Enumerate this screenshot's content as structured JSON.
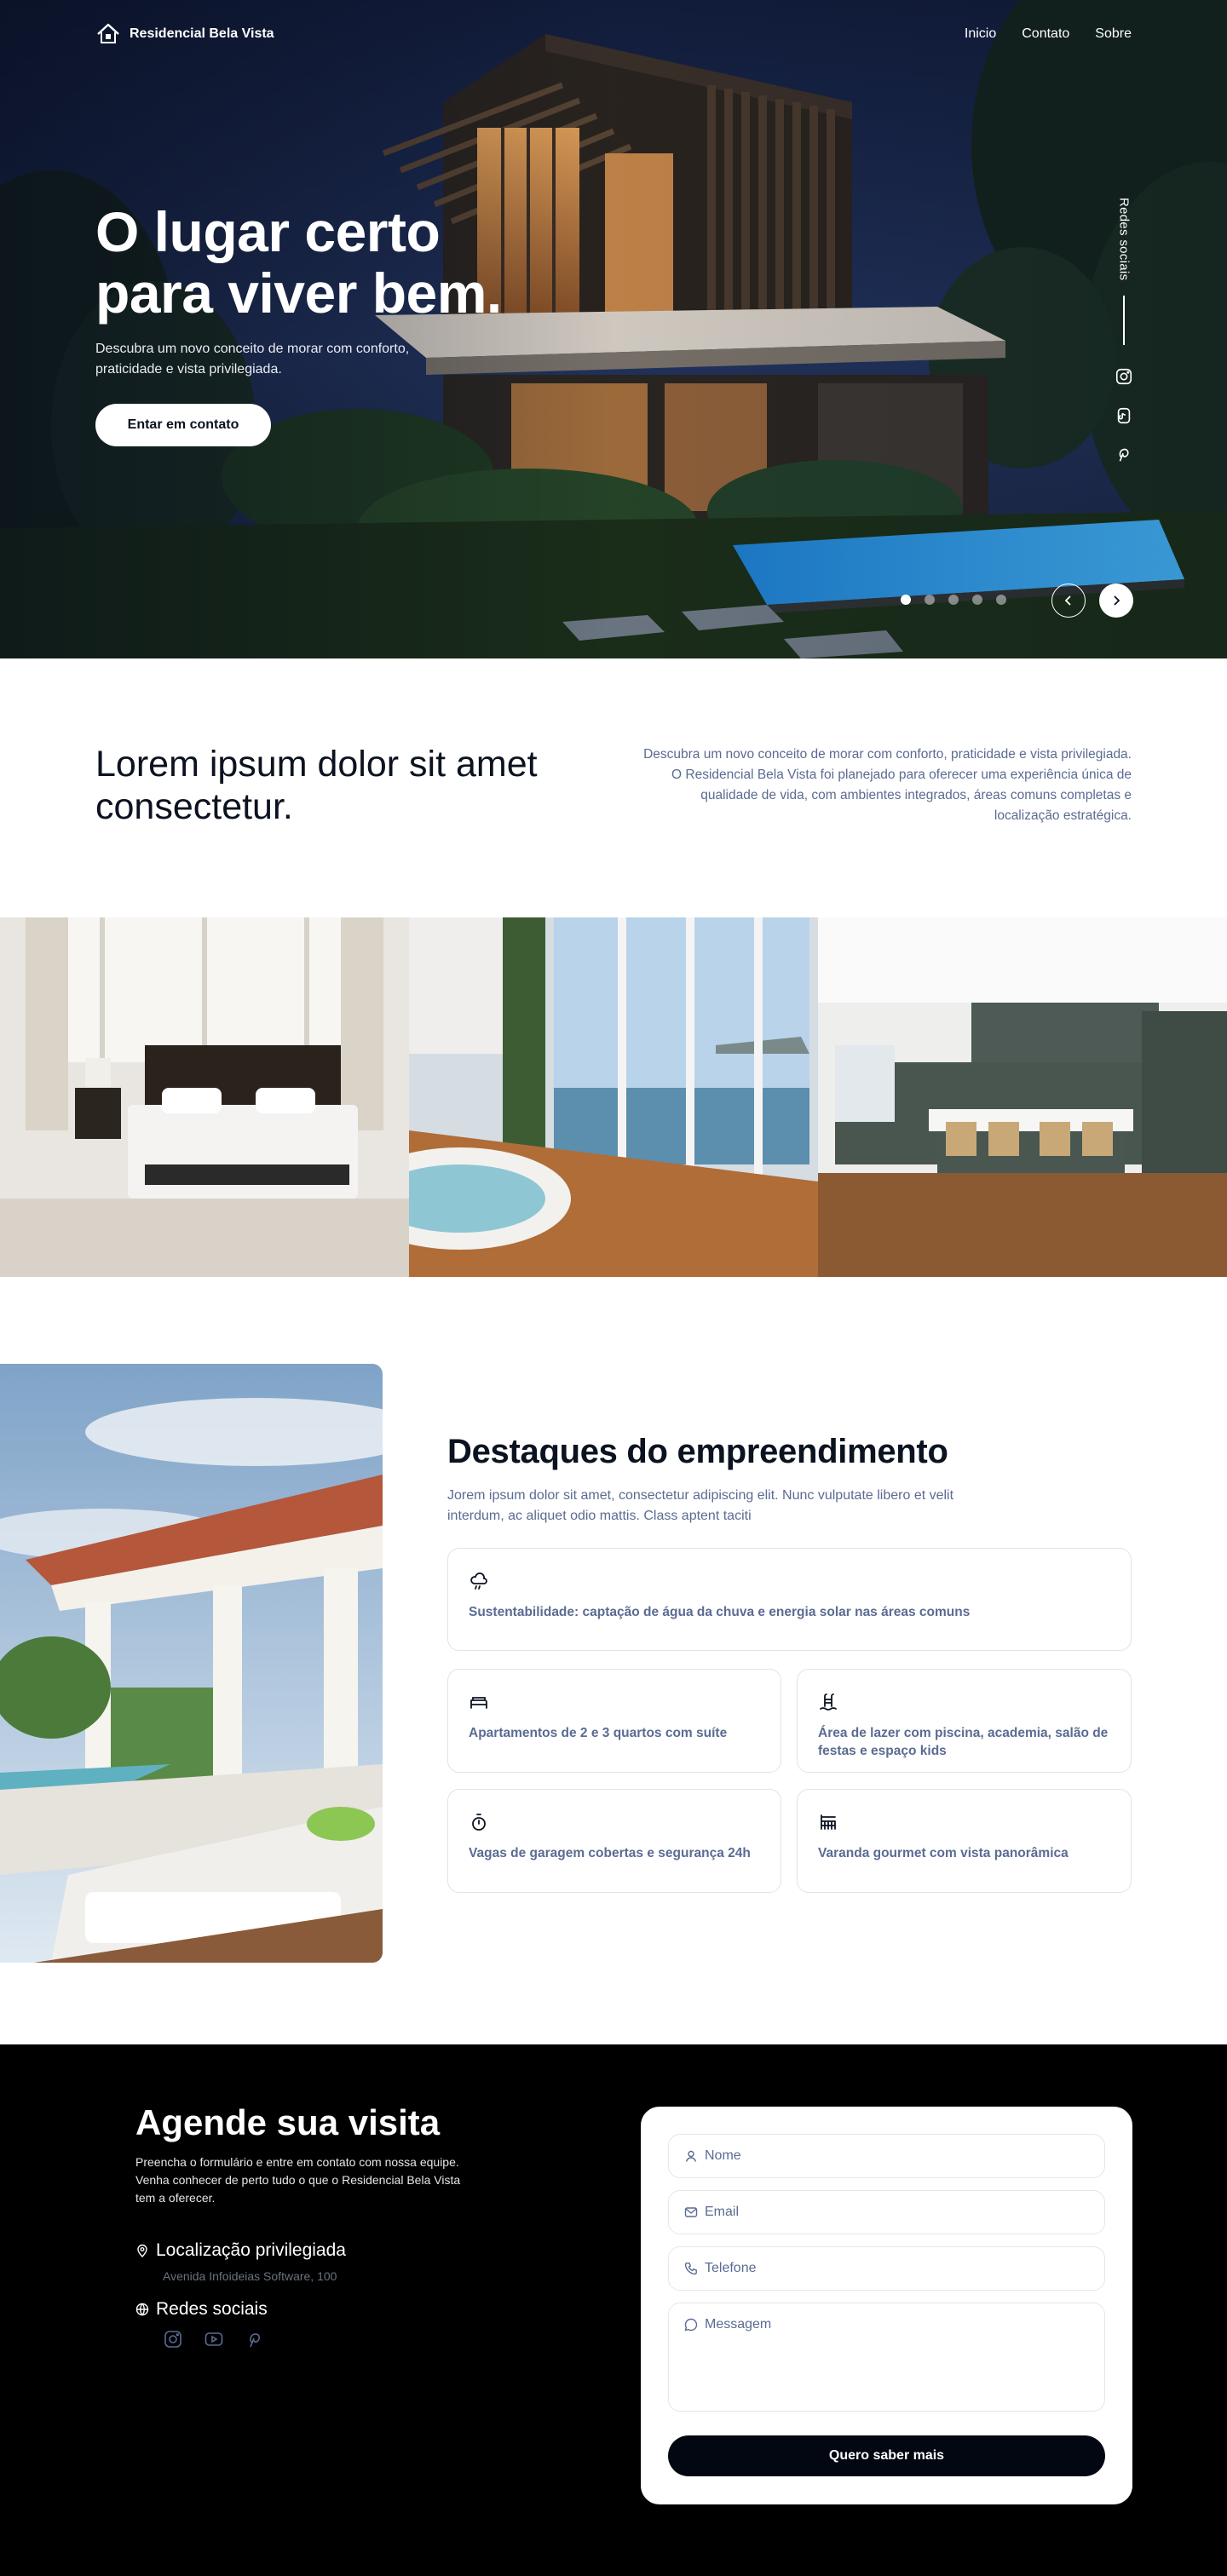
{
  "nav": {
    "brand": "Residencial Bela Vista",
    "links": [
      "Inicio",
      "Contato",
      "Sobre"
    ]
  },
  "hero": {
    "title": "O lugar certo\npara viver bem.",
    "subtitle": "Descubra um novo conceito de morar com conforto, praticidade e vista privilegiada.",
    "cta": "Entar em contato",
    "social_label": "Redes sociais",
    "social_icons": [
      "instagram-icon",
      "tiktok-icon",
      "pinterest-icon"
    ],
    "slides": 5,
    "active_slide": 1
  },
  "intro": {
    "title": "Lorem ipsum dolor sit amet consectetur.",
    "text": "Descubra um novo conceito de morar com conforto, praticidade e vista privilegiada. O Residencial Bela Vista foi planejado para oferecer uma experiência única de qualidade de vida, com ambientes integrados, áreas comuns completas e localização estratégica."
  },
  "features": {
    "title": "Destaques do empreendimento",
    "subtitle": "Jorem ipsum dolor sit amet, consectetur adipiscing elit. Nunc vulputate libero et velit interdum, ac aliquet odio mattis. Class aptent taciti",
    "cards": [
      {
        "icon": "cloud-rain-icon",
        "text": "Sustentabilidade: captação de água da chuva e energia solar nas áreas comuns"
      },
      {
        "icon": "bed-icon",
        "text": "Apartamentos de 2 e 3 quartos com suíte"
      },
      {
        "icon": "pool-ladder-icon",
        "text": "Área de lazer com piscina, academia, salão de festas e espaço kids"
      },
      {
        "icon": "timer-icon",
        "text": "Vagas de garagem cobertas e segurança 24h"
      },
      {
        "icon": "balcony-icon",
        "text": "Varanda gourmet com vista panorâmica"
      }
    ]
  },
  "contact": {
    "title": "Agende sua visita",
    "subtitle": "Preencha o formulário e entre em contato com nossa equipe. Venha conhecer de perto tudo o que o Residencial Bela Vista tem a oferecer.",
    "location_label": "Localização privilegiada",
    "address": "Avenida Infoideias Software, 100",
    "social_label": "Redes sociais",
    "social_icons": [
      "instagram-icon",
      "youtube-icon",
      "pinterest-icon"
    ],
    "form": {
      "name": "Nome",
      "email": "Email",
      "phone": "Telefone",
      "message": "Messagem",
      "submit": "Quero saber mais"
    }
  },
  "colors": {
    "accent_text": "#5b6b92",
    "dark": "#0b1220",
    "footer_bg": "#000000"
  }
}
